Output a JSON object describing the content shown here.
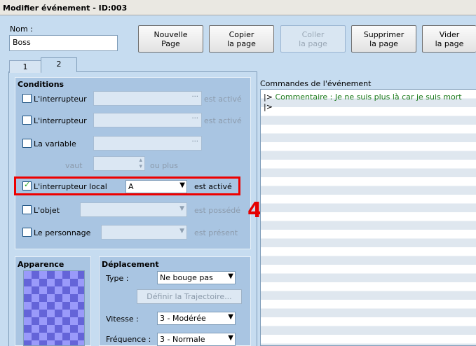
{
  "window": {
    "title": "Modifier événement - ID:003"
  },
  "nom": {
    "label": "Nom :",
    "value": "Boss"
  },
  "toolbar": {
    "buttons": [
      {
        "line1": "Nouvelle",
        "line2": "Page"
      },
      {
        "line1": "Copier",
        "line2": "la page"
      },
      {
        "line1": "Coller",
        "line2": "la page"
      },
      {
        "line1": "Supprimer",
        "line2": "la page"
      },
      {
        "line1": "Vider",
        "line2": "la page"
      }
    ]
  },
  "tabs": [
    {
      "label": "1"
    },
    {
      "label": "2"
    }
  ],
  "conditions": {
    "title": "Conditions",
    "switch1": {
      "label": "L'interrupteur",
      "status": "est activé",
      "checked": false
    },
    "switch2": {
      "label": "L'interrupteur",
      "status": "est activé",
      "checked": false
    },
    "variable": {
      "label": "La variable",
      "checked": false,
      "vaut": "vaut",
      "ou_plus": "ou plus"
    },
    "local_switch": {
      "label": "L'interrupteur local",
      "value": "A",
      "status": "est activé",
      "checked": true
    },
    "item": {
      "label": "L'objet",
      "status": "est possédé",
      "checked": false
    },
    "actor": {
      "label": "Le personnage",
      "status": "est présent",
      "checked": false
    }
  },
  "annotation": {
    "number": "4",
    "color": "#e60000"
  },
  "apparence": {
    "title": "Apparence"
  },
  "deplacement": {
    "title": "Déplacement",
    "type_label": "Type :",
    "type_value": "Ne bouge pas",
    "trajectoire_button": "Définir la Trajectoire...",
    "vitesse_label": "Vitesse :",
    "vitesse_value": "3 - Modérée",
    "frequence_label": "Fréquence :",
    "frequence_value": "3 - Normale"
  },
  "commands": {
    "title": "Commandes de l'événement",
    "lines": [
      {
        "marker": "|>",
        "text": "Commentaire : Je ne suis plus là car je suis mort"
      },
      {
        "marker": "|>",
        "text": ""
      }
    ]
  }
}
